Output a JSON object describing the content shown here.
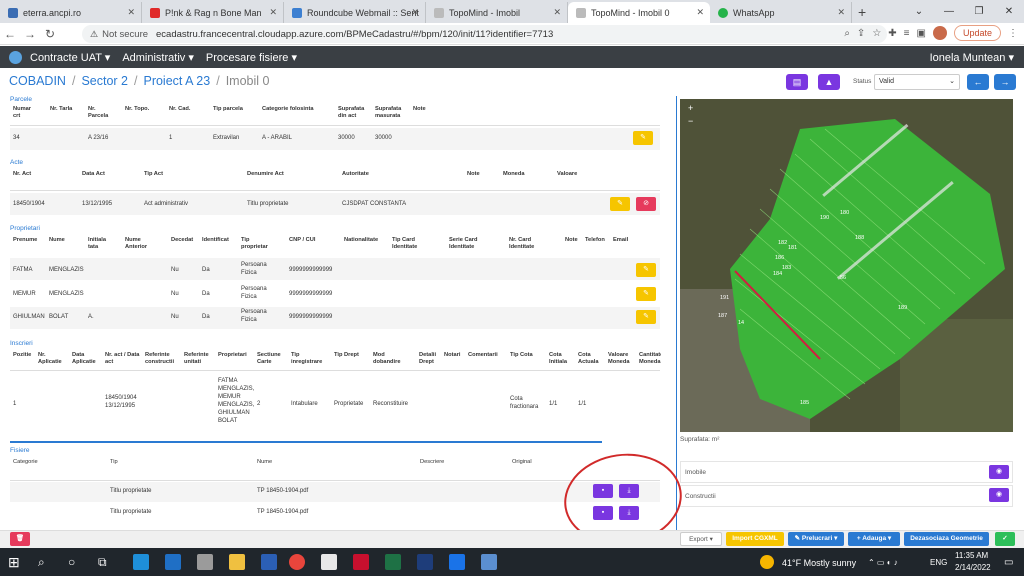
{
  "browser": {
    "tabs": [
      {
        "title": "eterra.ancpi.ro",
        "color": "#3b6db3"
      },
      {
        "title": "P!nk & Rag n Bone Man",
        "color": "#e02a2a"
      },
      {
        "title": "Roundcube Webmail :: Sent",
        "color": "#3c7fd1"
      },
      {
        "title": "TopoMind - Imobil",
        "color": "#888888"
      },
      {
        "title": "TopoMind - Imobil 0",
        "color": "#888888"
      },
      {
        "title": "WhatsApp",
        "color": "#25b34a"
      }
    ],
    "new_tab": "+",
    "not_secure": "Not secure",
    "url": "ecadastru.francecentral.cloudapp.azure.com/BPMeCadastru/#/bpm/120/init/11?identifier=7713",
    "update_label": "Update"
  },
  "appnav": {
    "menu": [
      "Contracte UAT ▾",
      "Administrativ ▾",
      "Procesare fisiere ▾"
    ],
    "user": "Ionela Muntean ▾"
  },
  "breadcrumb": [
    "COBADIN",
    "Sector 2",
    "Proiect A 23",
    "Imobil 0"
  ],
  "status": {
    "label": "Status",
    "value": "Valid"
  },
  "parcele": {
    "title": "Parcele",
    "headers": [
      "Numar crt",
      "Nr. Tarla",
      "Nr. Parcela",
      "Nr. Topo.",
      "Nr. Cad.",
      "Tip parcela",
      "Categorie folosinta",
      "Suprafata din act",
      "Suprafata masurata",
      "Note"
    ],
    "row": [
      "34",
      "",
      "A 23/16",
      "",
      "1",
      "Extravilan",
      "A - ARABIL",
      "30000",
      "30000",
      ""
    ]
  },
  "acte": {
    "title": "Acte",
    "headers": [
      "Nr. Act",
      "Data Act",
      "Tip Act",
      "Denumire Act",
      "Autoritate",
      "Note",
      "Moneda",
      "Valoare"
    ],
    "row": [
      "18450/1904",
      "13/12/1995",
      "Act administrativ",
      "Titlu proprietate",
      "CJSDPAT CONSTANTA",
      "",
      "",
      ""
    ]
  },
  "proprietari": {
    "title": "Proprietari",
    "headers": [
      "Prenume",
      "Nume",
      "Initiala tata",
      "Nume Anterior",
      "Decedat",
      "Identificat",
      "Tip proprietar",
      "CNP / CUI",
      "Nationalitate",
      "Tip Card Identitate",
      "Serie Card Identitate",
      "Nr. Card Identitate",
      "Note",
      "Telefon",
      "Email"
    ],
    "rows": [
      [
        "FATMA",
        "MENGLAZIS",
        "",
        "Nu",
        "Da",
        "Persoana Fizica",
        "9999999999999"
      ],
      [
        "MEMUR",
        "MENGLAZIS",
        "",
        "Nu",
        "Da",
        "Persoana Fizica",
        "9999999999999"
      ],
      [
        "GHIULMAN",
        "BOLAT",
        "A.",
        "Nu",
        "Da",
        "Persoana Fizica",
        "9999999999999"
      ]
    ]
  },
  "inscrieri": {
    "title": "Inscrieri",
    "headers": [
      "Pozitie",
      "Nr. Aplicatie",
      "Data Aplicatie",
      "Nr. act / Data act",
      "Referinte constructii",
      "Referinte unitati",
      "Proprietari",
      "Sectiune Carte",
      "Tip inregistrare",
      "Tip Drept",
      "Mod dobandire",
      "Detalii Drept",
      "Notari",
      "Comentarii",
      "Tip Cota",
      "Cota Initiala",
      "Cota Actuala",
      "Valoare Moneda",
      "Cantitate Moneda"
    ],
    "row": {
      "pozitie": "1",
      "act": "18450/1904 13/12/1995",
      "proprietari": "FATMA MENGLAZIS, MEMUR MENGLAZIS, GHIULMAN BOLAT",
      "sectiune": "2",
      "tip_inreg": "Intabulare",
      "tip_drept": "Proprietate",
      "mod": "Reconstituire",
      "tip_cota": "Cota fractionara",
      "cota_init": "1/1",
      "cota_act": "1/1"
    }
  },
  "fisiere": {
    "title": "Fisiere",
    "headers": [
      "Categorie",
      "Tip",
      "Nume",
      "Descriere",
      "Original"
    ],
    "rows": [
      {
        "tip": "Titlu proprietate",
        "nume": "TP 18450-1904.pdf"
      },
      {
        "tip": "Titlu proprietate",
        "nume": "TP 18450-1904.pdf"
      }
    ]
  },
  "map": {
    "suprafata": "Suprafata: m²",
    "labels": [
      "190",
      "191",
      "187",
      "186",
      "184",
      "183",
      "182",
      "181",
      "180",
      "188",
      "189",
      "185",
      "56",
      "14"
    ]
  },
  "right_panel": {
    "imobile": "Imobile",
    "constructii": "Constructii"
  },
  "bottom_bar": {
    "export": "Export ▾",
    "import": "Import CGXML",
    "prelucrari": "✎ Prelucrari ▾",
    "adauga": "+ Adauga ▾",
    "dezasociaza": "Dezasociaza Geometrie"
  },
  "taskbar": {
    "weather": "41°F  Mostly sunny",
    "lang": "ENG",
    "time": "11:35 AM",
    "date": "2/14/2022"
  },
  "colors": {
    "accent": "#2a7ad2",
    "purple": "#7a36e0",
    "yellow": "#f6c500",
    "red": "#e63a5c",
    "green": "#2dbf5a"
  }
}
